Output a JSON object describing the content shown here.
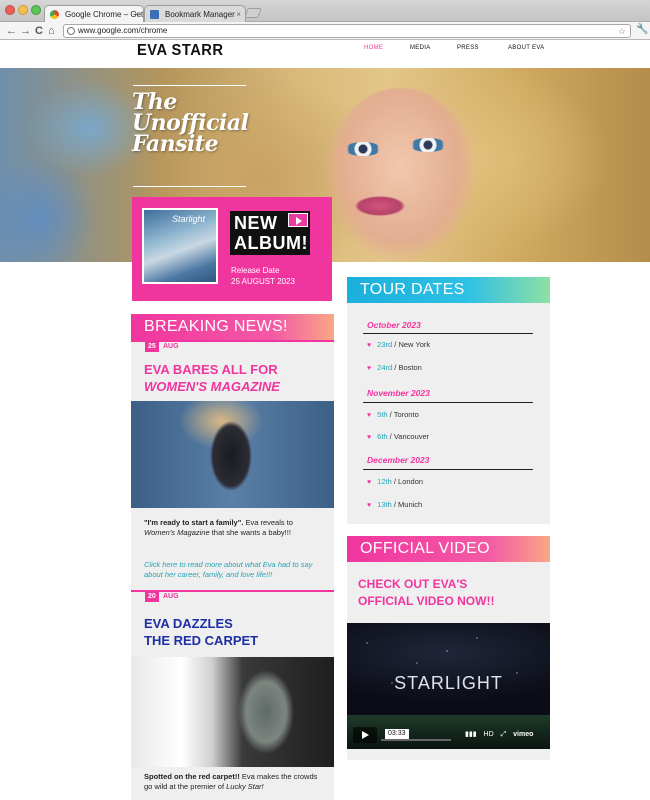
{
  "browser": {
    "tabs": [
      {
        "label": "Google Chrome – Get a fast"
      },
      {
        "label": "Bookmark Manager"
      }
    ],
    "url": "www.google.com/chrome",
    "nav": {
      "back": "←",
      "forward": "→",
      "reload": "C",
      "home": "⌂"
    }
  },
  "site": {
    "logo": "EVA STARR",
    "nav": [
      "HOME",
      "MEDIA",
      "PRESS",
      "ABOUT EVA"
    ],
    "hero_title": [
      "The",
      "Unofficial",
      "Fansite"
    ]
  },
  "album": {
    "cover_text": "Starlight",
    "headline_1": "NEW",
    "headline_2": "ALBUM!",
    "release_label": "Release Date",
    "release_date": "25 AUGUST 2023"
  },
  "news": {
    "heading": "BREAKING NEWS!",
    "items": [
      {
        "day": "25",
        "month": "AUG",
        "headline_1": "EVA BARES ALL FOR",
        "headline_2": "WOMEN'S MAGAZINE",
        "lead_bold": "\"I'm ready to start a family\".",
        "body_1": " Eva reveals to ",
        "body_em": "Women's Magazine",
        "body_2": " that she wants a baby!!!",
        "link": "Click here to read more about what Eva had to say about her career, family, and love life!!!"
      },
      {
        "day": "20",
        "month": "AUG",
        "headline_1": "EVA DAZZLES",
        "headline_2": "THE RED CARPET",
        "lead_bold": "Spotted on the red carpet!!",
        "body_1": " Eva makes the crowds go wild at the premier of ",
        "body_em": "Lucky Star!"
      }
    ]
  },
  "tour": {
    "heading": "TOUR DATES",
    "months": [
      {
        "name": "October 2023",
        "gigs": [
          {
            "day": "23rd",
            "city": "New York"
          },
          {
            "day": "24rd",
            "city": "Boston"
          }
        ]
      },
      {
        "name": "November 2023",
        "gigs": [
          {
            "day": "5th",
            "city": "Toronto"
          },
          {
            "day": "6th",
            "city": "Vancouver"
          }
        ]
      },
      {
        "name": "December 2023",
        "gigs": [
          {
            "day": "12th",
            "city": "London"
          },
          {
            "day": "13th",
            "city": "Munich"
          }
        ]
      }
    ]
  },
  "video": {
    "heading": "OFFICIAL VIDEO",
    "tagline_1": "CHECK OUT EVA'S",
    "tagline_2": "OFFICIAL VIDEO NOW!!",
    "player_title": "STARLIGHT",
    "timecode": "03:33",
    "hd_label": "HD",
    "brand": "vimeo"
  },
  "colors": {
    "accent_pink": "#f0359f",
    "accent_teal": "#1ab0dc",
    "headline_blue": "#1d2fa3"
  },
  "icons": [
    "close-icon",
    "back-icon",
    "forward-icon",
    "reload-icon",
    "home-icon",
    "star-icon",
    "wrench-icon",
    "play-icon",
    "heart-icon",
    "fullscreen-icon"
  ]
}
